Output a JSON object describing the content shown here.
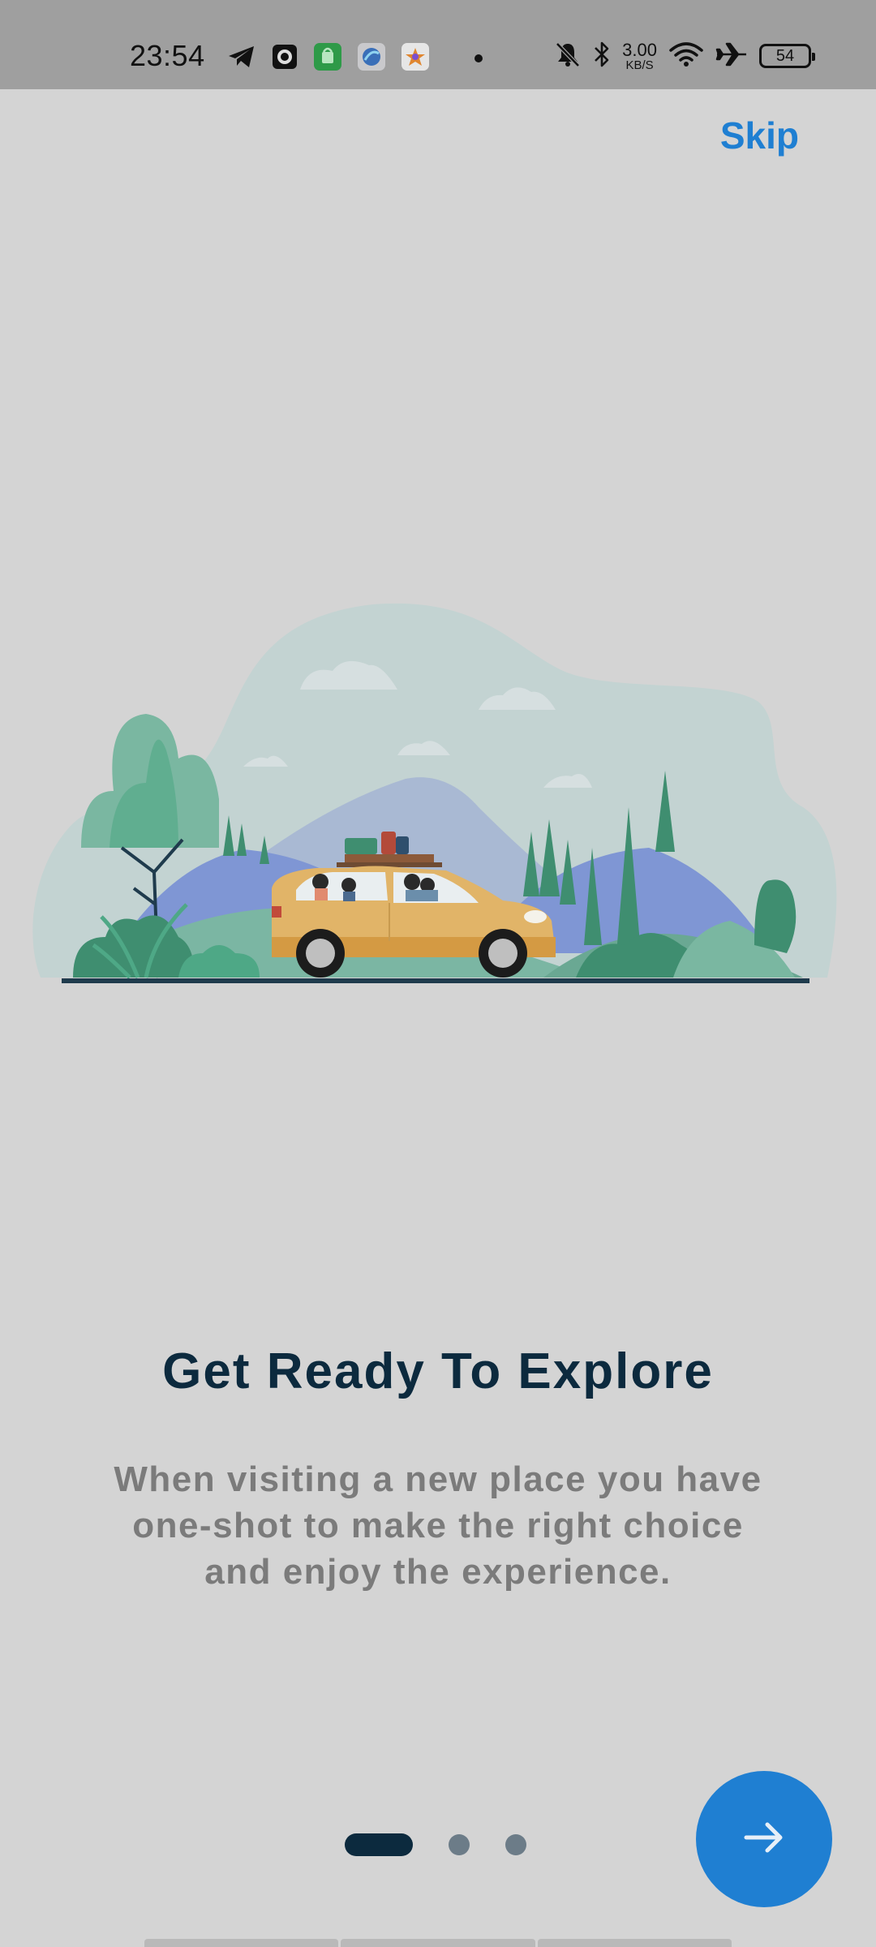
{
  "status_bar": {
    "time": "23:54",
    "left_icons": [
      "telegram-icon",
      "camera-record-icon",
      "shopping-bag-icon",
      "blue-app-icon",
      "star-app-icon",
      "dot-indicator-icon"
    ],
    "right_icons": [
      "mute-icon",
      "bluetooth-icon",
      "wifi-icon",
      "airplane-icon"
    ],
    "net_speed_value": "3.00",
    "net_speed_unit": "KB/S",
    "battery": "54"
  },
  "onboarding": {
    "skip_label": "Skip",
    "title": "Get Ready To Explore",
    "description_lines": [
      "When visiting a new place you have",
      "one-shot to make the right choice",
      "and enjoy the experience."
    ],
    "page_count": 3,
    "current_page": 1,
    "next_icon": "arrow-right-icon"
  },
  "colors": {
    "background": "#d4d4d4",
    "status_bar": "#9f9f9f",
    "accent": "#1f7fd2",
    "title": "#0c2a3e",
    "description": "#7b7b7b",
    "indicator_active": "#0c2a3e",
    "indicator_inactive": "#6c7c88"
  }
}
